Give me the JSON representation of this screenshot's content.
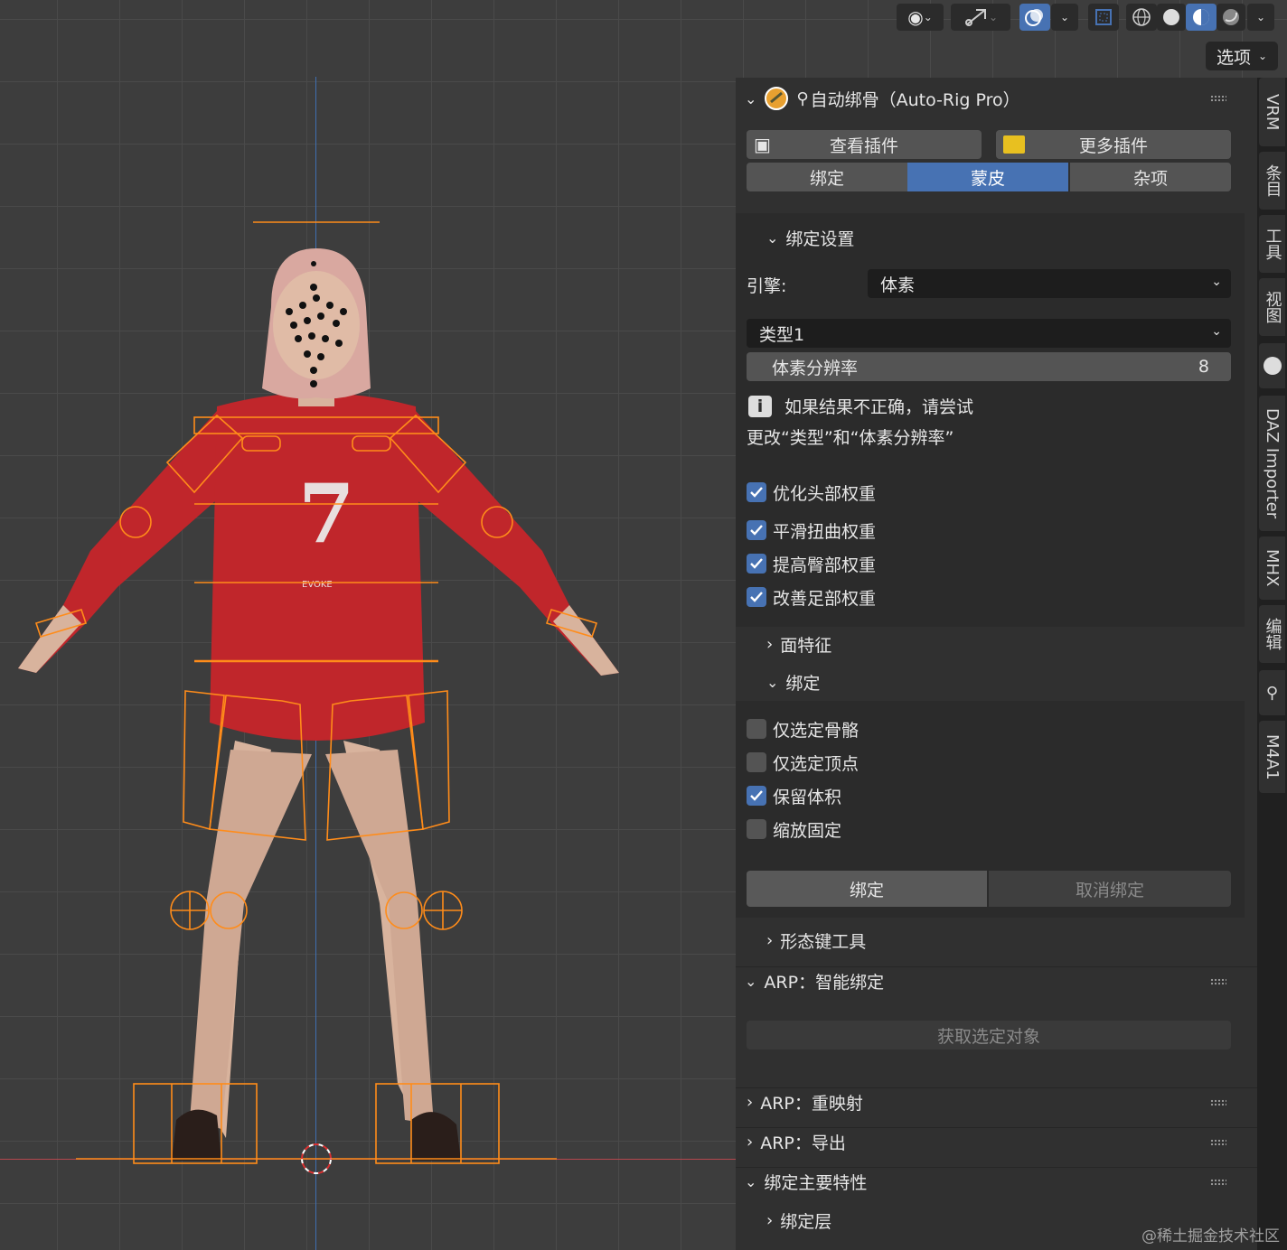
{
  "header": {
    "options_label": "选项"
  },
  "panel": {
    "addon_title": "自动绑骨（Auto-Rig Pro）",
    "view_addons": "查看插件",
    "more_addons": "更多插件",
    "tabs": [
      "绑定",
      "蒙皮",
      "杂项"
    ],
    "active_tab": "蒙皮",
    "bind_settings_label": "绑定设置",
    "engine_label": "引擎:",
    "engine_value": "体素",
    "type_value": "类型1",
    "voxel_res_label": "体素分辨率",
    "voxel_res_value": "8",
    "info_line1": "如果结果不正确，请尝试",
    "info_line2": "更改“类型”和“体素分辨率”",
    "options": [
      {
        "label": "优化头部权重",
        "checked": true
      },
      {
        "label": "平滑扭曲权重",
        "checked": true
      },
      {
        "label": "提高臀部权重",
        "checked": true
      },
      {
        "label": "改善足部权重",
        "checked": true
      }
    ],
    "facial_label": "面特征",
    "bind_sub_label": "绑定",
    "bind_options": [
      {
        "label": "仅选定骨骼",
        "checked": false
      },
      {
        "label": "仅选定顶点",
        "checked": false
      },
      {
        "label": "保留体积",
        "checked": true
      },
      {
        "label": "缩放固定",
        "checked": false
      }
    ],
    "bind_button": "绑定",
    "unbind_button": "取消绑定",
    "shapekey_label": "形态键工具",
    "smart_label": "ARP：智能绑定",
    "get_selected": "获取选定对象",
    "remap_label": "ARP：重映射",
    "export_label": "ARP：导出",
    "rig_main_label": "绑定主要特性",
    "rig_layers_label": "绑定层"
  },
  "tabs_side": [
    "VRM",
    "条目",
    "工具",
    "视图",
    "DAZ Importer",
    "MHX",
    "编辑",
    "M4A1"
  ],
  "watermark": "@稀土掘金技术社区",
  "colors": {
    "accent": "#4772b3",
    "bone": "#ff8c1a",
    "sweater": "#c0262b"
  }
}
